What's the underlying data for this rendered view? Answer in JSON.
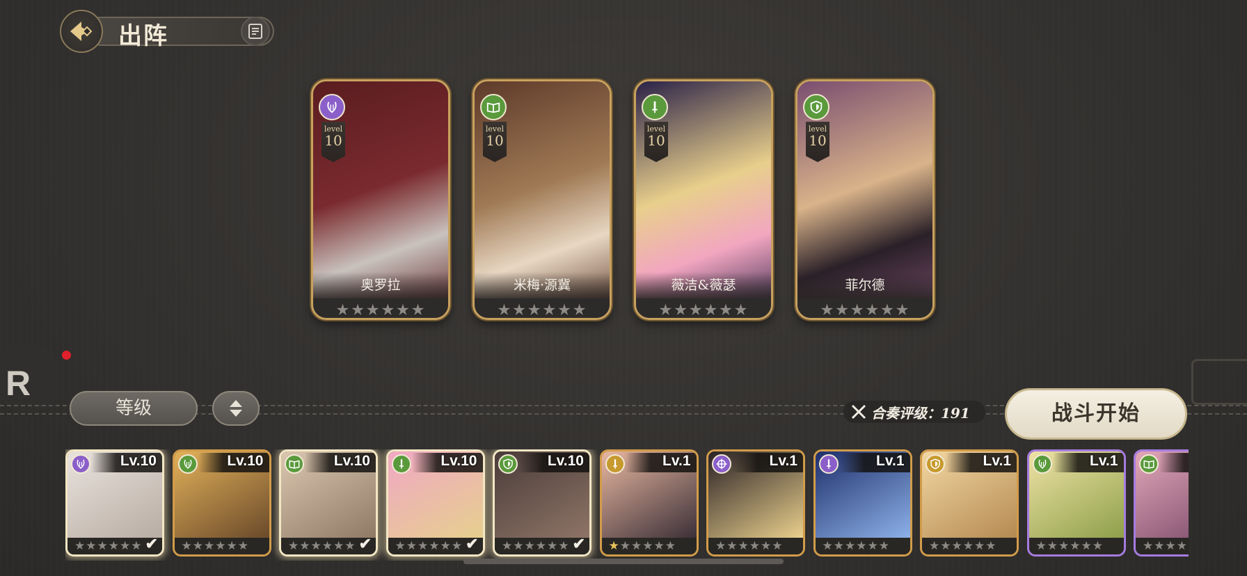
{
  "header": {
    "title": "出阵"
  },
  "colors": {
    "gold": "#c8a15e",
    "lyre": "#8b5fc9",
    "green": "#5a9a3c",
    "gold_role": "#c79a2f"
  },
  "team": [
    {
      "name": "奥罗拉",
      "role_icon": "lyre-icon",
      "level_word": "level",
      "level": "10",
      "stars": 6,
      "role_color": "#8b5fc9",
      "art": [
        "#5a1d20",
        "#c9c2bd",
        "#7a2a2e"
      ]
    },
    {
      "name": "米梅·源冀",
      "role_icon": "book-icon",
      "level_word": "level",
      "level": "10",
      "stars": 6,
      "role_color": "#5a9a3c",
      "art": [
        "#5e3a2a",
        "#e8d7c3",
        "#a07a55"
      ]
    },
    {
      "name": "薇洁&薇瑟",
      "role_icon": "sword-icon",
      "level_word": "level",
      "level": "10",
      "stars": 6,
      "role_color": "#5a9a3c",
      "art": [
        "#2b2248",
        "#f2a6c0",
        "#e8cf8c"
      ]
    },
    {
      "name": "菲尔德",
      "role_icon": "shield-icon",
      "level_word": "level",
      "level": "10",
      "stars": 6,
      "role_color": "#5a9a3c",
      "art": [
        "#7a4e70",
        "#2a2028",
        "#d9b38a"
      ]
    }
  ],
  "controls": {
    "sort_label": "等级",
    "rating_label": "合奏评级：191",
    "start_label": "战斗开始",
    "r_label": "R"
  },
  "roster": [
    {
      "level": "Lv.10",
      "role_icon": "lyre-icon",
      "role_color": "#8b5fc9",
      "selected": true,
      "stars_on": 0,
      "frame": "gold",
      "art": [
        "#e9e3dd",
        "#b8aca3"
      ]
    },
    {
      "level": "Lv.10",
      "role_icon": "lyre-icon",
      "role_color": "#5a9a3c",
      "selected": false,
      "stars_on": 0,
      "frame": "gold",
      "art": [
        "#e2b15a",
        "#6b4a2a"
      ]
    },
    {
      "level": "Lv.10",
      "role_icon": "book-icon",
      "role_color": "#5a9a3c",
      "selected": true,
      "stars_on": 0,
      "frame": "gold",
      "art": [
        "#dbc7b0",
        "#8f7a66"
      ]
    },
    {
      "level": "Lv.10",
      "role_icon": "sword-icon",
      "role_color": "#5a9a3c",
      "selected": true,
      "stars_on": 0,
      "frame": "gold",
      "art": [
        "#f0a8c4",
        "#e6cf8e"
      ]
    },
    {
      "level": "Lv.10",
      "role_icon": "shield-icon",
      "role_color": "#5a9a3c",
      "selected": true,
      "stars_on": 0,
      "frame": "gold",
      "art": [
        "#4a3c3a",
        "#8e7466"
      ]
    },
    {
      "level": "Lv.1",
      "role_icon": "sword-icon",
      "role_color": "#c79a2f",
      "selected": false,
      "stars_on": 1,
      "frame": "gold",
      "art": [
        "#e8b7a0",
        "#3c3038"
      ]
    },
    {
      "level": "Lv.1",
      "role_icon": "crosshair-icon",
      "role_color": "#8b5fc9",
      "selected": false,
      "stars_on": 0,
      "frame": "gold",
      "art": [
        "#2a2226",
        "#e9cf8c"
      ]
    },
    {
      "level": "Lv.1",
      "role_icon": "sword-icon",
      "role_color": "#8b5fc9",
      "selected": false,
      "stars_on": 0,
      "frame": "gold",
      "art": [
        "#1f2f6a",
        "#8cb0e8"
      ]
    },
    {
      "level": "Lv.1",
      "role_icon": "shield-icon",
      "role_color": "#c79a2f",
      "selected": false,
      "stars_on": 0,
      "frame": "gold",
      "art": [
        "#f2d7a2",
        "#b58a52"
      ]
    },
    {
      "level": "Lv.1",
      "role_icon": "lyre-icon",
      "role_color": "#5a9a3c",
      "selected": false,
      "stars_on": 0,
      "frame": "purple",
      "art": [
        "#efe2a6",
        "#8ea04a"
      ]
    },
    {
      "level": "",
      "role_icon": "book-icon",
      "role_color": "#5a9a3c",
      "selected": false,
      "stars_on": 0,
      "frame": "purple",
      "art": [
        "#e2a7b8",
        "#7a4a6a"
      ]
    }
  ]
}
